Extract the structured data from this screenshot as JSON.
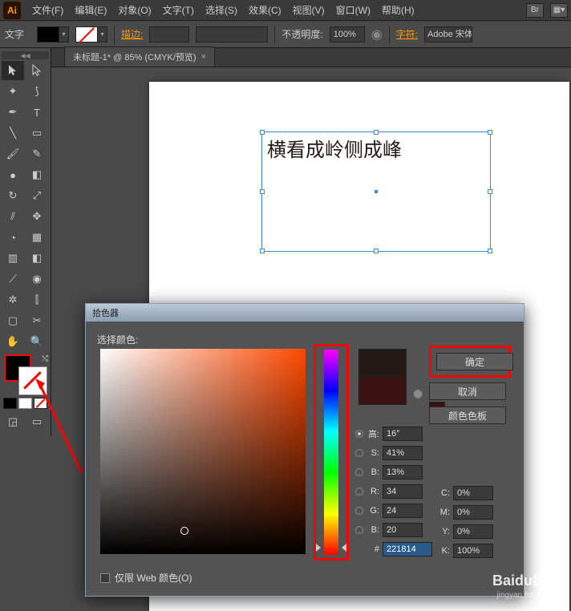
{
  "menubar": {
    "app": "Ai",
    "items": [
      "文件(F)",
      "编辑(E)",
      "对象(O)",
      "文字(T)",
      "选择(S)",
      "效果(C)",
      "视图(V)",
      "窗口(W)",
      "帮助(H)"
    ],
    "right_btn1": "Br",
    "right_btn2": "▦▾"
  },
  "optionsbar": {
    "tool_label": "文字",
    "stroke_label": "描边:",
    "stroke_weight": "",
    "opacity_label": "不透明度:",
    "opacity_value": "100%",
    "char_label": "字符:",
    "font": "Adobe 宋体"
  },
  "tab": {
    "title": "未标题-1* @ 85% (CMYK/预览)",
    "close": "×"
  },
  "canvas": {
    "text_content": "横看成岭侧成峰"
  },
  "color_picker": {
    "title": "拾色器",
    "select_label": "选择颜色:",
    "ok": "确定",
    "cancel": "取消",
    "swatches": "颜色色板",
    "hsb": {
      "h_label": "高:",
      "h": "16°",
      "s_label": "S:",
      "s": "41%",
      "b_label": "B:",
      "b": "13%"
    },
    "rgb": {
      "r_label": "R:",
      "r": "34",
      "g_label": "G:",
      "g": "24",
      "b_label": "B:",
      "b": "20"
    },
    "cmyk": {
      "c_label": "C:",
      "c": "0%",
      "m_label": "M:",
      "m": "0%",
      "y_label": "Y:",
      "y": "0%",
      "k_label": "K:",
      "k": "100%"
    },
    "hex_label": "#",
    "hex": "221814",
    "web_only": "仅限 Web 颜色(O)"
  },
  "watermark": {
    "brand": "Baidu经验",
    "url": "jingyan.baidu.com"
  }
}
